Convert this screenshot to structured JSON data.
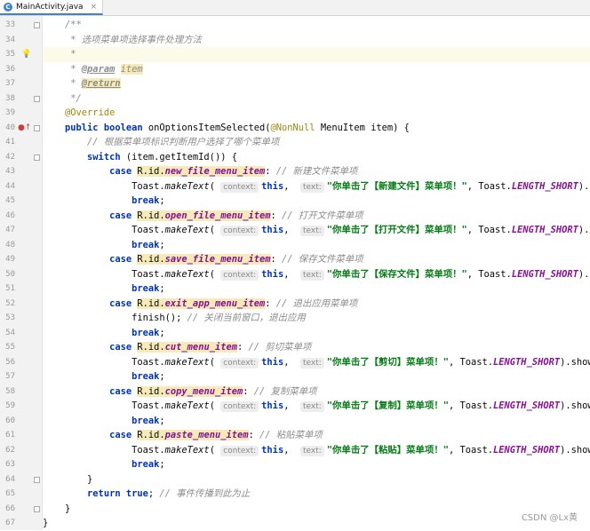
{
  "tab": {
    "icon": "C",
    "name": "MainActivity.java",
    "close": "×"
  },
  "watermark": "CSDN @Lx黄",
  "lines": [
    {
      "n": "33",
      "parts": [
        {
          "s": "    "
        },
        {
          "t": "c",
          "s": "/**"
        }
      ]
    },
    {
      "n": "34",
      "parts": [
        {
          "s": "     "
        },
        {
          "t": "c",
          "s": "* 选项菜单项选择事件处理方法"
        }
      ]
    },
    {
      "n": "35",
      "cur": true,
      "parts": [
        {
          "s": "     "
        },
        {
          "t": "c",
          "s": "*"
        }
      ]
    },
    {
      "n": "36",
      "parts": [
        {
          "s": "     "
        },
        {
          "t": "c",
          "s": "* "
        },
        {
          "t": "tag",
          "s": "@param"
        },
        {
          "s": " "
        },
        {
          "t": "c hl",
          "s": "item"
        }
      ]
    },
    {
      "n": "37",
      "parts": [
        {
          "s": "     "
        },
        {
          "t": "c",
          "s": "* "
        },
        {
          "t": "tag hl",
          "s": "@return"
        }
      ]
    },
    {
      "n": "38",
      "parts": [
        {
          "s": "     "
        },
        {
          "t": "c",
          "s": "*/"
        }
      ]
    },
    {
      "n": "39",
      "parts": [
        {
          "s": "    "
        },
        {
          "t": "ann",
          "s": "@Override"
        }
      ]
    },
    {
      "n": "40",
      "parts": [
        {
          "s": "    "
        },
        {
          "t": "kw",
          "s": "public boolean"
        },
        {
          "s": " onOptionsItemSelected("
        },
        {
          "t": "ann",
          "s": "@NonNull"
        },
        {
          "s": " MenuItem item) {"
        }
      ]
    },
    {
      "n": "41",
      "parts": [
        {
          "s": "        "
        },
        {
          "t": "c",
          "s": "// 根据菜单项标识判断用户选择了哪个菜单项"
        }
      ]
    },
    {
      "n": "42",
      "parts": [
        {
          "s": "        "
        },
        {
          "t": "kw",
          "s": "switch"
        },
        {
          "s": " (item.getItemId()) {"
        }
      ]
    },
    {
      "n": "43",
      "parts": [
        {
          "s": "            "
        },
        {
          "t": "kw",
          "s": "case"
        },
        {
          "s": " "
        },
        {
          "t": "hl",
          "s": "R.id."
        },
        {
          "t": "f hl",
          "s": "new_file_menu_item"
        },
        {
          "s": ": "
        },
        {
          "t": "c",
          "s": "// 新建文件菜单项"
        }
      ]
    },
    {
      "n": "44",
      "parts": [
        {
          "s": "                Toast."
        },
        {
          "t": "m",
          "s": "makeText"
        },
        {
          "s": "( "
        },
        {
          "t": "hint",
          "s": "context:"
        },
        {
          "t": "kw",
          "s": "this"
        },
        {
          "s": ",  "
        },
        {
          "t": "hint",
          "s": "text:"
        },
        {
          "t": "str",
          "s": "\"你单击了【新建文件】菜单项！\""
        },
        {
          "s": ", Toast."
        },
        {
          "t": "f",
          "s": "LENGTH_SHORT"
        },
        {
          "s": ").show();"
        }
      ]
    },
    {
      "n": "45",
      "parts": [
        {
          "s": "                "
        },
        {
          "t": "kw",
          "s": "break"
        },
        {
          "s": ";"
        }
      ]
    },
    {
      "n": "46",
      "parts": [
        {
          "s": "            "
        },
        {
          "t": "kw",
          "s": "case"
        },
        {
          "s": " "
        },
        {
          "t": "hl",
          "s": "R.id."
        },
        {
          "t": "f hl",
          "s": "open_file_menu_item"
        },
        {
          "s": ": "
        },
        {
          "t": "c",
          "s": "// 打开文件菜单项"
        }
      ]
    },
    {
      "n": "47",
      "parts": [
        {
          "s": "                Toast."
        },
        {
          "t": "m",
          "s": "makeText"
        },
        {
          "s": "( "
        },
        {
          "t": "hint",
          "s": "context:"
        },
        {
          "t": "kw",
          "s": "this"
        },
        {
          "s": ",  "
        },
        {
          "t": "hint",
          "s": "text:"
        },
        {
          "t": "str",
          "s": "\"你单击了【打开文件】菜单项！\""
        },
        {
          "s": ", Toast."
        },
        {
          "t": "f",
          "s": "LENGTH_SHORT"
        },
        {
          "s": ").show();"
        }
      ]
    },
    {
      "n": "48",
      "parts": [
        {
          "s": "                "
        },
        {
          "t": "kw",
          "s": "break"
        },
        {
          "s": ";"
        }
      ]
    },
    {
      "n": "49",
      "parts": [
        {
          "s": "            "
        },
        {
          "t": "kw",
          "s": "case"
        },
        {
          "s": " "
        },
        {
          "t": "hl",
          "s": "R.id."
        },
        {
          "t": "f hl",
          "s": "save_file_menu_item"
        },
        {
          "s": ": "
        },
        {
          "t": "c",
          "s": "// 保存文件菜单项"
        }
      ]
    },
    {
      "n": "50",
      "parts": [
        {
          "s": "                Toast."
        },
        {
          "t": "m",
          "s": "makeText"
        },
        {
          "s": "( "
        },
        {
          "t": "hint",
          "s": "context:"
        },
        {
          "t": "kw",
          "s": "this"
        },
        {
          "s": ",  "
        },
        {
          "t": "hint",
          "s": "text:"
        },
        {
          "t": "str",
          "s": "\"你单击了【保存文件】菜单项！\""
        },
        {
          "s": ", Toast."
        },
        {
          "t": "f",
          "s": "LENGTH_SHORT"
        },
        {
          "s": ").show();"
        }
      ]
    },
    {
      "n": "51",
      "parts": [
        {
          "s": "                "
        },
        {
          "t": "kw",
          "s": "break"
        },
        {
          "s": ";"
        }
      ]
    },
    {
      "n": "52",
      "parts": [
        {
          "s": "            "
        },
        {
          "t": "kw",
          "s": "case"
        },
        {
          "s": " "
        },
        {
          "t": "hl",
          "s": "R.id."
        },
        {
          "t": "f hl",
          "s": "exit_app_menu_item"
        },
        {
          "s": ": "
        },
        {
          "t": "c",
          "s": "// 退出应用菜单项"
        }
      ]
    },
    {
      "n": "53",
      "parts": [
        {
          "s": "                finish(); "
        },
        {
          "t": "c",
          "s": "// 关闭当前窗口，退出应用"
        }
      ]
    },
    {
      "n": "54",
      "parts": [
        {
          "s": "                "
        },
        {
          "t": "kw",
          "s": "break"
        },
        {
          "s": ";"
        }
      ]
    },
    {
      "n": "55",
      "parts": [
        {
          "s": "            "
        },
        {
          "t": "kw",
          "s": "case"
        },
        {
          "s": " "
        },
        {
          "t": "hl",
          "s": "R.id."
        },
        {
          "t": "f hl",
          "s": "cut_menu_item"
        },
        {
          "s": ": "
        },
        {
          "t": "c",
          "s": "// 剪切菜单项"
        }
      ]
    },
    {
      "n": "56",
      "parts": [
        {
          "s": "                Toast."
        },
        {
          "t": "m",
          "s": "makeText"
        },
        {
          "s": "( "
        },
        {
          "t": "hint",
          "s": "context:"
        },
        {
          "t": "kw",
          "s": "this"
        },
        {
          "s": ",  "
        },
        {
          "t": "hint",
          "s": "text:"
        },
        {
          "t": "str",
          "s": "\"你单击了【剪切】菜单项！\""
        },
        {
          "s": ", Toast."
        },
        {
          "t": "f",
          "s": "LENGTH_SHORT"
        },
        {
          "s": ").show();"
        }
      ]
    },
    {
      "n": "57",
      "parts": [
        {
          "s": "                "
        },
        {
          "t": "kw",
          "s": "break"
        },
        {
          "s": ";"
        }
      ]
    },
    {
      "n": "58",
      "parts": [
        {
          "s": "            "
        },
        {
          "t": "kw",
          "s": "case"
        },
        {
          "s": " "
        },
        {
          "t": "hl",
          "s": "R.id."
        },
        {
          "t": "f hl",
          "s": "copy_menu_item"
        },
        {
          "s": ": "
        },
        {
          "t": "c",
          "s": "// 复制菜单项"
        }
      ]
    },
    {
      "n": "59",
      "parts": [
        {
          "s": "                Toast."
        },
        {
          "t": "m",
          "s": "makeText"
        },
        {
          "s": "( "
        },
        {
          "t": "hint",
          "s": "context:"
        },
        {
          "t": "kw",
          "s": "this"
        },
        {
          "s": ",  "
        },
        {
          "t": "hint",
          "s": "text:"
        },
        {
          "t": "str",
          "s": "\"你单击了【复制】菜单项！\""
        },
        {
          "s": ", Toast."
        },
        {
          "t": "f",
          "s": "LENGTH_SHORT"
        },
        {
          "s": ").show();"
        }
      ]
    },
    {
      "n": "60",
      "parts": [
        {
          "s": "                "
        },
        {
          "t": "kw",
          "s": "break"
        },
        {
          "s": ";"
        }
      ]
    },
    {
      "n": "61",
      "parts": [
        {
          "s": "            "
        },
        {
          "t": "kw",
          "s": "case"
        },
        {
          "s": " "
        },
        {
          "t": "hl",
          "s": "R.id."
        },
        {
          "t": "f hl",
          "s": "paste_menu_item"
        },
        {
          "s": ": "
        },
        {
          "t": "c",
          "s": "// 粘贴菜单项"
        }
      ]
    },
    {
      "n": "62",
      "parts": [
        {
          "s": "                Toast."
        },
        {
          "t": "m",
          "s": "makeText"
        },
        {
          "s": "( "
        },
        {
          "t": "hint",
          "s": "context:"
        },
        {
          "t": "kw",
          "s": "this"
        },
        {
          "s": ",  "
        },
        {
          "t": "hint",
          "s": "text:"
        },
        {
          "t": "str",
          "s": "\"你单击了【粘贴】菜单项！\""
        },
        {
          "s": ", Toast."
        },
        {
          "t": "f",
          "s": "LENGTH_SHORT"
        },
        {
          "s": ").show();"
        }
      ]
    },
    {
      "n": "63",
      "parts": [
        {
          "s": "                "
        },
        {
          "t": "kw",
          "s": "break"
        },
        {
          "s": ";"
        }
      ]
    },
    {
      "n": "64",
      "parts": [
        {
          "s": "        }"
        }
      ]
    },
    {
      "n": "65",
      "parts": [
        {
          "s": "        "
        },
        {
          "t": "kw",
          "s": "return true"
        },
        {
          "s": "; "
        },
        {
          "t": "c",
          "s": "// 事件传播到此为止"
        }
      ]
    },
    {
      "n": "66",
      "parts": [
        {
          "s": "    }"
        }
      ]
    },
    {
      "n": "67",
      "parts": [
        {
          "s": "}"
        }
      ]
    }
  ]
}
